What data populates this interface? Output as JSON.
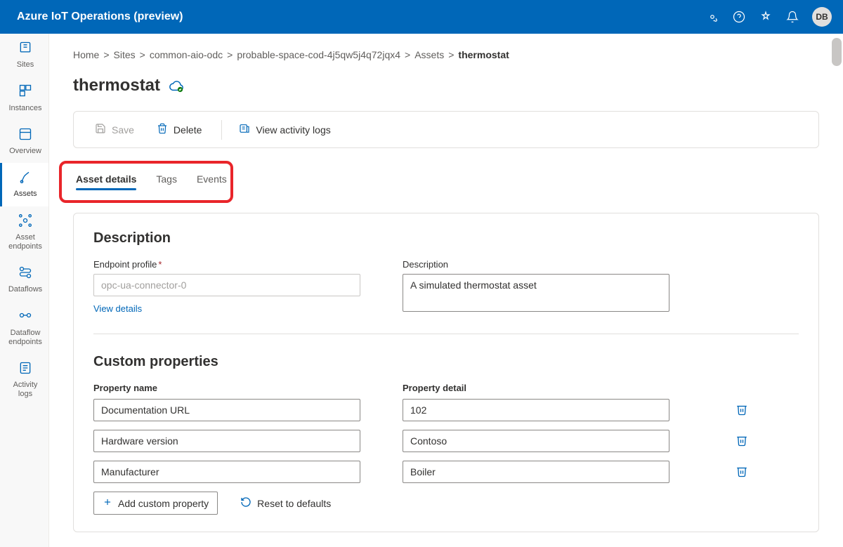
{
  "header": {
    "title": "Azure IoT Operations (preview)",
    "avatar": "DB"
  },
  "sidebar": {
    "items": [
      {
        "label": "Sites"
      },
      {
        "label": "Instances"
      },
      {
        "label": "Overview"
      },
      {
        "label": "Assets"
      },
      {
        "label": "Asset endpoints"
      },
      {
        "label": "Dataflows"
      },
      {
        "label": "Dataflow endpoints"
      },
      {
        "label": "Activity logs"
      }
    ]
  },
  "breadcrumb": {
    "items": [
      "Home",
      "Sites",
      "common-aio-odc",
      "probable-space-cod-4j5qw5j4q72jqx4",
      "Assets",
      "thermostat"
    ]
  },
  "page": {
    "title": "thermostat"
  },
  "toolbar": {
    "save": "Save",
    "delete": "Delete",
    "activity": "View activity logs"
  },
  "tabs": [
    {
      "label": "Asset details"
    },
    {
      "label": "Tags"
    },
    {
      "label": "Events"
    }
  ],
  "description": {
    "section_title": "Description",
    "endpoint_label": "Endpoint profile",
    "endpoint_value": "opc-ua-connector-0",
    "view_details": "View details",
    "desc_label": "Description",
    "desc_value": "A simulated thermostat asset"
  },
  "custom": {
    "section_title": "Custom properties",
    "header_name": "Property name",
    "header_detail": "Property detail",
    "rows": [
      {
        "name": "Documentation URL",
        "detail": "102"
      },
      {
        "name": "Hardware version",
        "detail": "Contoso"
      },
      {
        "name": "Manufacturer",
        "detail": "Boiler"
      }
    ],
    "add": "Add custom property",
    "reset": "Reset to defaults"
  }
}
